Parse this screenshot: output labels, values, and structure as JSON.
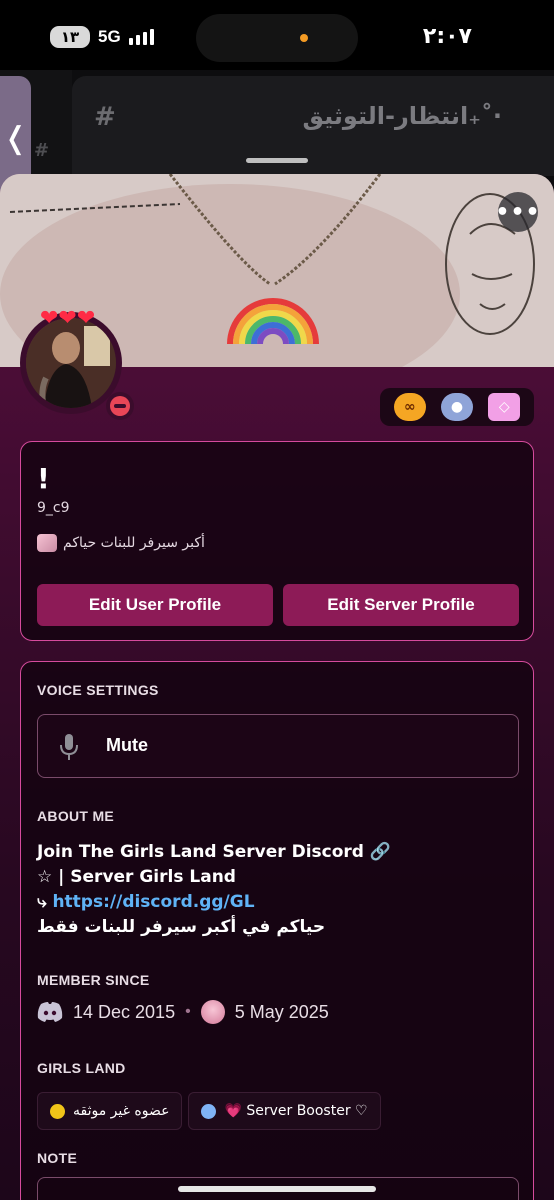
{
  "status_bar": {
    "battery": "١٣",
    "network": "5G",
    "time": "٢:٠٧"
  },
  "background": {
    "channel_name": "·˚₊انتظار-التوثيق",
    "hash": "#"
  },
  "profile": {
    "more_icon": "more-dots-icon",
    "display_name": "!",
    "username": "9_c9",
    "custom_status": "أكبر سيرفر للبنات حياكم",
    "status": "do-not-disturb",
    "badges": [
      "nitro-badge",
      "clown-badge",
      "boost-badge"
    ],
    "edit_user_profile": "Edit User Profile",
    "edit_server_profile": "Edit Server Profile"
  },
  "voice_settings": {
    "label": "VOICE SETTINGS",
    "mute_label": "Mute"
  },
  "about_me": {
    "label": "ABOUT ME",
    "line1": "Join The Girls Land Server Discord 🔗",
    "line2": "☆ | Server Girls Land",
    "line3_prefix": "⤷ ",
    "line3_link": "https://discord.gg/GL",
    "line4": "حياكم في أكبر سيرفر للبنات فقط"
  },
  "member_since": {
    "label": "MEMBER SINCE",
    "discord_date": "14 Dec 2015",
    "server_date": "5 May 2025"
  },
  "server_roles": {
    "label": "GIRLS LAND",
    "roles": [
      {
        "name": "عضوه غير موثقه",
        "color": "#f0c419"
      },
      {
        "name": "💗 Server Booster ♡",
        "color": "#7fb3f5"
      }
    ]
  },
  "note": {
    "label": "NOTE"
  },
  "colors": {
    "accent": "#d64b9d",
    "button": "#8d1b57",
    "link": "#5fb3f6",
    "dnd": "#e84657"
  }
}
